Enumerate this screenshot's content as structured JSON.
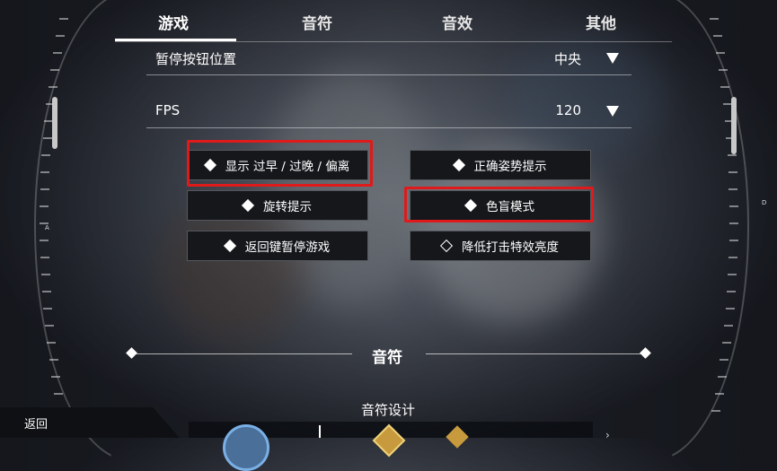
{
  "tabs": [
    {
      "label": "游戏",
      "active": true
    },
    {
      "label": "音符",
      "active": false
    },
    {
      "label": "音效",
      "active": false
    },
    {
      "label": "其他",
      "active": false
    }
  ],
  "settings": {
    "pause_button_position": {
      "label": "暂停按钮位置",
      "value": "中央"
    },
    "fps": {
      "label": "FPS",
      "value": "120"
    }
  },
  "options": {
    "show_early_late": {
      "label": "显示 过早 / 过晚 / 偏离",
      "enabled": true,
      "highlighted": true
    },
    "correct_pose_hint": {
      "label": "正确姿势提示",
      "enabled": true,
      "highlighted": false
    },
    "rotation_hint": {
      "label": "旋转提示",
      "enabled": true,
      "highlighted": false
    },
    "colorblind_mode": {
      "label": "色盲模式",
      "enabled": true,
      "highlighted": true
    },
    "back_key_pause": {
      "label": "返回键暂停游戏",
      "enabled": true,
      "highlighted": false
    },
    "reduce_hit_effect_brightness": {
      "label": "降低打击特效亮度",
      "enabled": false,
      "highlighted": false
    }
  },
  "section": {
    "title": "音符",
    "subtitle": "音符设计"
  },
  "back": {
    "label": "返回"
  },
  "side_letters": {
    "left": "A",
    "right": "D"
  },
  "colors": {
    "highlight": "#e01a1a",
    "accent_blue": "#7ab0e6",
    "gold": "#c69a3d"
  }
}
